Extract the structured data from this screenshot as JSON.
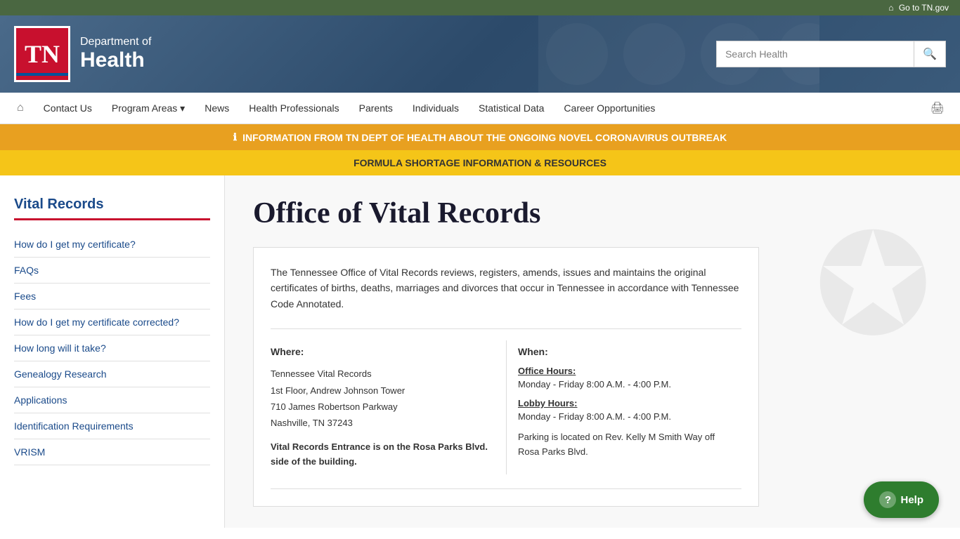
{
  "topbar": {
    "go_to_tn": "Go to TN.gov"
  },
  "header": {
    "logo_text": "TN",
    "dept_of": "Department of",
    "health": "Health",
    "search_placeholder": "Search Health"
  },
  "nav": {
    "home_icon": "⌂",
    "items": [
      {
        "label": "Contact Us",
        "has_dropdown": false
      },
      {
        "label": "Program Areas",
        "has_dropdown": true
      },
      {
        "label": "News",
        "has_dropdown": false
      },
      {
        "label": "Health Professionals",
        "has_dropdown": false
      },
      {
        "label": "Parents",
        "has_dropdown": false
      },
      {
        "label": "Individuals",
        "has_dropdown": false
      },
      {
        "label": "Statistical Data",
        "has_dropdown": false
      },
      {
        "label": "Career Opportunities",
        "has_dropdown": false
      }
    ],
    "print_icon": "🖨"
  },
  "alerts": {
    "coronavirus": "INFORMATION FROM TN DEPT OF HEALTH ABOUT THE ONGOING NOVEL CORONAVIRUS OUTBREAK",
    "formula": "FORMULA SHORTAGE INFORMATION & RESOURCES",
    "info_icon": "ℹ"
  },
  "sidebar": {
    "title": "Vital Records",
    "links": [
      "How do I get my certificate?",
      "FAQs",
      "Fees",
      "How do I get my certificate corrected?",
      "How long will it take?",
      "Genealogy Research",
      "Applications",
      "Identification Requirements",
      "VRISM"
    ]
  },
  "content": {
    "page_title": "Office of Vital Records",
    "intro": "The Tennessee Office of Vital Records reviews, registers, amends, issues and maintains the original certificates of births, deaths, marriages and divorces that occur in Tennessee in accordance with Tennessee Code Annotated.",
    "where_label": "Where:",
    "when_label": "When:",
    "address_line1": "Tennessee Vital Records",
    "address_line2": "1st Floor, Andrew Johnson Tower",
    "address_line3": "710 James Robertson Parkway",
    "address_line4": "Nashville, TN  37243",
    "entrance_text": "Vital Records Entrance is on the Rosa Parks Blvd. side of the building.",
    "office_hours_title": "Office Hours:",
    "office_hours_text": "Monday - Friday   8:00 A.M. - 4:00 P.M.",
    "lobby_hours_title": "Lobby Hours:",
    "lobby_hours_text": "Monday - Friday   8:00 A.M. - 4:00 P.M.",
    "parking_text": "Parking is located on Rev. Kelly M Smith Way off Rosa Parks Blvd."
  },
  "help_button": {
    "label": "Help",
    "icon": "?"
  }
}
